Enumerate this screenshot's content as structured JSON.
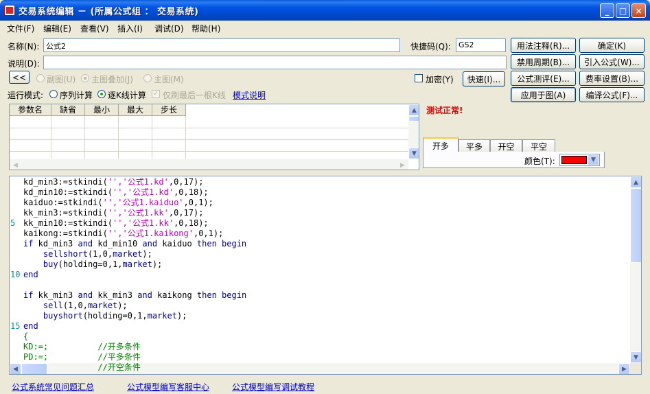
{
  "window": {
    "title": "交易系统编辑 － (所属公式组 ： 交易系统)",
    "minimize": "_",
    "maximize": "□",
    "close": "×"
  },
  "menu": [
    "文件(F)",
    "编辑(E)",
    "查看(V)",
    "插入(I)",
    "调试(D)",
    "帮助(H)"
  ],
  "form": {
    "name_label": "名称(N):",
    "name_value": "公式2",
    "shortcut_label": "快捷码(Q):",
    "shortcut_value": "GS2",
    "desc_label": "说明(D):",
    "desc_value": "",
    "collapse_label": "<<",
    "radio_sub": "副图(U)",
    "radio_main_overlay": "主图叠加(J)",
    "radio_main": "主图(M)",
    "encrypt_label": "加密(Y)",
    "run_mode_label": "运行模式:",
    "run_mode_seq": "序列计算",
    "run_mode_kline": "逐K线计算",
    "last_bar_only": "仅刷最后一根K线",
    "mode_help_link": "模式说明"
  },
  "buttons": {
    "fast": "快速(I)...",
    "usage_comment": "用法注释(R)...",
    "disable_period": "禁用周期(B)...",
    "formula_test": "公式测评(E)...",
    "apply_to_chart": "应用于图(A)",
    "ok": "确定(K)",
    "import_formula": "引入公式(W)...",
    "fee_setting": "费率设置(B)...",
    "compile_formula": "编译公式(F)..."
  },
  "params": {
    "columns": [
      "参数名",
      "缺省",
      "最小",
      "最大",
      "步长"
    ],
    "rows": []
  },
  "status": "测试正常!",
  "signal_tabs": [
    "开多",
    "平多",
    "开空",
    "平空"
  ],
  "active_signal_tab": 0,
  "color_label": "颜色(T):",
  "signal_color": "#FF0000",
  "editor_lines": [
    {
      "ln": "",
      "parts": [
        [
          "",
          "kd_min3:=stkindi("
        ],
        [
          "str",
          "'','公式1.kd'"
        ],
        [
          "",
          ",0,17);"
        ]
      ]
    },
    {
      "ln": "",
      "parts": [
        [
          "",
          "kd_min10:=stkindi("
        ],
        [
          "str",
          "'','公式1.kd'"
        ],
        [
          "",
          ",0,18);"
        ]
      ]
    },
    {
      "ln": "",
      "parts": [
        [
          "",
          "kaiduo:=stkindi("
        ],
        [
          "str",
          "'','公式1.kaiduo'"
        ],
        [
          "",
          ",0,1);"
        ]
      ]
    },
    {
      "ln": "",
      "parts": [
        [
          "",
          "kk_min3:=stkindi("
        ],
        [
          "str",
          "'','公式1.kk'"
        ],
        [
          "",
          ",0,17);"
        ]
      ]
    },
    {
      "ln": "5",
      "parts": [
        [
          "",
          "kk_min10:=stkindi("
        ],
        [
          "str",
          "'','公式1.kk'"
        ],
        [
          "",
          ",0,18);"
        ]
      ]
    },
    {
      "ln": "",
      "parts": [
        [
          "",
          "kaikong:=stkindi("
        ],
        [
          "str",
          "'','公式1.kaikong'"
        ],
        [
          "",
          ",0,1);"
        ]
      ]
    },
    {
      "ln": "",
      "parts": [
        [
          "kw",
          "if"
        ],
        [
          "",
          " kd_min3 "
        ],
        [
          "kw",
          "and"
        ],
        [
          "",
          " kd_min10 "
        ],
        [
          "kw",
          "and"
        ],
        [
          "",
          " kaiduo "
        ],
        [
          "kw",
          "then begin"
        ]
      ]
    },
    {
      "ln": "",
      "parts": [
        [
          "",
          "    "
        ],
        [
          "kw",
          "sellshort"
        ],
        [
          "",
          "(1,0,"
        ],
        [
          "kw",
          "market"
        ],
        [
          "",
          ");"
        ]
      ]
    },
    {
      "ln": "",
      "parts": [
        [
          "",
          "    "
        ],
        [
          "kw",
          "buy"
        ],
        [
          "",
          "(holding=0,1,"
        ],
        [
          "kw",
          "market"
        ],
        [
          "",
          ");"
        ]
      ]
    },
    {
      "ln": "10",
      "parts": [
        [
          "kw",
          "end"
        ]
      ]
    },
    {
      "ln": "",
      "parts": [
        [
          "",
          ""
        ]
      ]
    },
    {
      "ln": "",
      "parts": [
        [
          "kw",
          "if"
        ],
        [
          "",
          " kk_min3 "
        ],
        [
          "kw",
          "and"
        ],
        [
          "",
          " kk_min3 "
        ],
        [
          "kw",
          "and"
        ],
        [
          "",
          " kaikong "
        ],
        [
          "kw",
          "then begin"
        ]
      ]
    },
    {
      "ln": "",
      "parts": [
        [
          "",
          "    "
        ],
        [
          "kw",
          "sell"
        ],
        [
          "",
          "(1,0,"
        ],
        [
          "kw",
          "market"
        ],
        [
          "",
          ");"
        ]
      ]
    },
    {
      "ln": "",
      "parts": [
        [
          "",
          "    "
        ],
        [
          "kw",
          "buyshort"
        ],
        [
          "",
          "(holding=0,1,"
        ],
        [
          "kw",
          "market"
        ],
        [
          "",
          ");"
        ]
      ]
    },
    {
      "ln": "15",
      "parts": [
        [
          "kw",
          "end"
        ]
      ]
    },
    {
      "ln": "",
      "parts": [
        [
          "cm",
          "{"
        ]
      ]
    },
    {
      "ln": "",
      "parts": [
        [
          "cm",
          "KD:=;          //开多条件"
        ]
      ]
    },
    {
      "ln": "",
      "parts": [
        [
          "cm",
          "PD:=;          //平多条件"
        ]
      ]
    },
    {
      "ln": "",
      "parts": [
        [
          "cm",
          "               //开空条件"
        ]
      ]
    }
  ],
  "footer_links": [
    "公式系统常见问题汇总",
    "公式模型编写客服中心",
    "公式模型编写调试教程"
  ]
}
